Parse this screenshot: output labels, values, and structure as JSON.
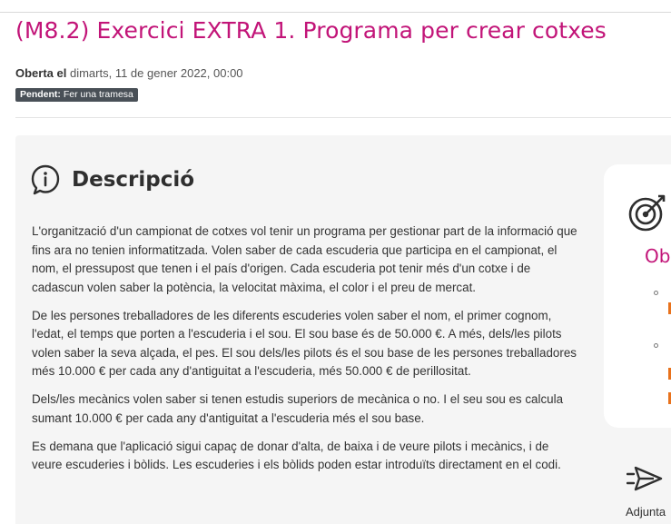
{
  "title": "(M8.2) Exercici EXTRA 1. Programa per crear cotxes",
  "opened": {
    "label": "Oberta el",
    "date": "dimarts, 11 de gener 2022, 00:00"
  },
  "status": {
    "label": "Pendent:",
    "text": "Fer una tramesa"
  },
  "description": {
    "heading": "Descripció",
    "paragraphs": [
      "L'organització d'un campionat de cotxes vol tenir un programa per gestionar part de la informació que fins ara no tenien informatitzada. Volen saber de cada escuderia que participa en el campionat, el nom, el pressupost que tenen i el país d'origen. Cada escuderia pot tenir més d'un cotxe i de cadascun volen saber la potència, la velocitat màxima, el color i el preu de mercat.",
      "De les persones treballadores de les diferents escuderies volen saber el nom, el primer cognom, l'edat, el temps que porten a l'escuderia i el sou. El sou base és de 50.000 €. A més, dels/les pilots volen saber la seva alçada, el pes. El sou dels/les pilots és el sou base de les persones treballadores més 10.000 € per cada any d'antiguitat a l'escuderia, més 50.000 € de perillositat.",
      "Dels/les mecànics volen saber si tenen estudis superiors de mecànica o no. I el seu sou es calcula sumant 10.000 € per cada any d'antiguitat a l'escuderia més el sou base.",
      "Es demana que l'aplicació sigui capaç de donar d'alta, de baixa i de veure pilots i mecànics, i de veure escuderies i bòlids. Les escuderies i els bòlids poden estar introduïts directament en el codi."
    ]
  },
  "objectives": {
    "heading": "Ob"
  },
  "submit": {
    "label": "Adjunta"
  },
  "colors": {
    "accent": "#c21478",
    "badge_bg": "#495057",
    "panel_bg": "#f5f5f5",
    "highlight": "#e8721c"
  },
  "icons": {
    "description": "info-speech-icon",
    "objectives": "target-dart-icon",
    "submit": "paper-plane-icon"
  }
}
